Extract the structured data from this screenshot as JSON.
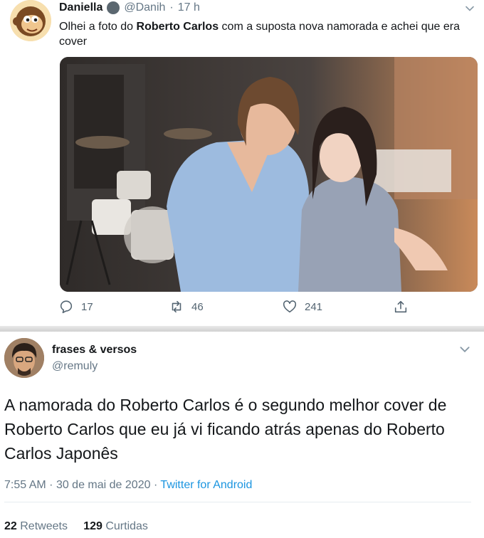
{
  "tweet1": {
    "author_name": "Daniella",
    "handle": "@Danih",
    "time": "17 h",
    "text_before": "Olhei a foto do ",
    "text_bold": "Roberto Carlos",
    "text_after": " com a suposta nova namorada e achei que era cover",
    "replies": "17",
    "retweets": "46",
    "likes": "241"
  },
  "tweet2": {
    "author_name": "frases & versos",
    "handle": "@remuly",
    "text": "A namorada do Roberto Carlos é o segundo melhor cover de Roberto Carlos que eu já vi ficando atrás apenas do Roberto Carlos Japonês",
    "time": "7:55 AM",
    "date": "30 de mai de 2020",
    "source": "Twitter for Android",
    "retweets_count": "22",
    "retweets_label": "Retweets",
    "likes_count": "129",
    "likes_label": "Curtidas"
  },
  "icons": {
    "reply": "reply-icon",
    "retweet": "retweet-icon",
    "like": "heart-icon",
    "share": "share-icon",
    "caret": "chevron-down-icon",
    "verified": "verified-badge-icon"
  },
  "colors": {
    "link": "#1b95e0",
    "secondary_text": "#657786",
    "primary_text": "#14171a"
  }
}
